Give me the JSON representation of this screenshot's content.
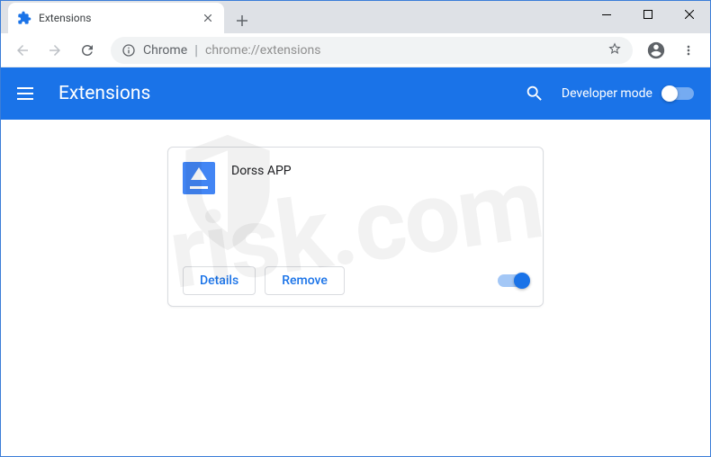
{
  "window": {
    "title": "Extensions"
  },
  "tab": {
    "title": "Extensions"
  },
  "addressbar": {
    "chrome_label": "Chrome",
    "url": "chrome://extensions"
  },
  "header": {
    "title": "Extensions",
    "dev_mode_label": "Developer mode",
    "dev_mode_on": false
  },
  "extension": {
    "name": "Dorss APP",
    "details_label": "Details",
    "remove_label": "Remove",
    "enabled": true
  },
  "watermark": {
    "text": "risk.com"
  }
}
